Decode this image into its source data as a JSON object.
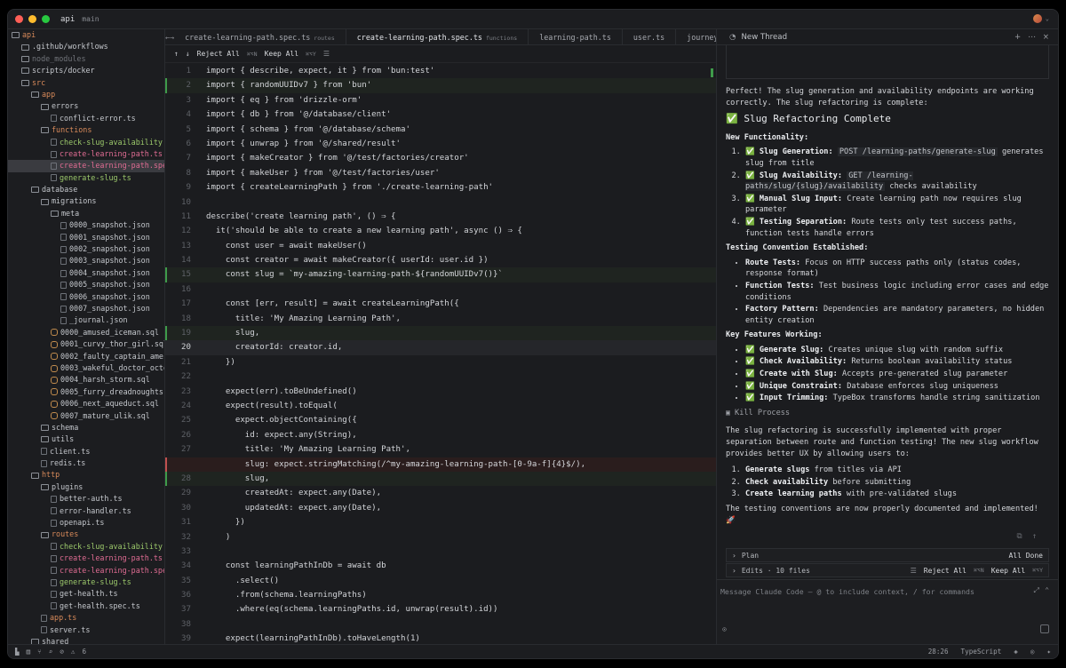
{
  "titlebar": {
    "project": "api",
    "branch": "main"
  },
  "sidebar": {
    "items": [
      {
        "label": "api",
        "depth": 0,
        "kind": "folder",
        "color": "orange"
      },
      {
        "label": ".github/workflows",
        "depth": 1,
        "kind": "folder",
        "color": ""
      },
      {
        "label": "node_modules",
        "depth": 1,
        "kind": "folder",
        "color": "dim"
      },
      {
        "label": "scripts/docker",
        "depth": 1,
        "kind": "folder",
        "color": ""
      },
      {
        "label": "src",
        "depth": 1,
        "kind": "folder",
        "color": "orange"
      },
      {
        "label": "app",
        "depth": 2,
        "kind": "folder",
        "color": "orange"
      },
      {
        "label": "errors",
        "depth": 3,
        "kind": "folder",
        "color": ""
      },
      {
        "label": "conflict-error.ts",
        "depth": 4,
        "kind": "file",
        "color": ""
      },
      {
        "label": "functions",
        "depth": 3,
        "kind": "folder",
        "color": "orange"
      },
      {
        "label": "check-slug-availability.ts",
        "depth": 4,
        "kind": "file",
        "color": "green"
      },
      {
        "label": "create-learning-path.ts",
        "depth": 4,
        "kind": "file",
        "color": "pink"
      },
      {
        "label": "create-learning-path.spec.ts",
        "depth": 4,
        "kind": "file",
        "color": "pink",
        "selected": true
      },
      {
        "label": "generate-slug.ts",
        "depth": 4,
        "kind": "file",
        "color": "green"
      },
      {
        "label": "database",
        "depth": 2,
        "kind": "folder",
        "color": ""
      },
      {
        "label": "migrations",
        "depth": 3,
        "kind": "folder",
        "color": ""
      },
      {
        "label": "meta",
        "depth": 4,
        "kind": "folder",
        "color": ""
      },
      {
        "label": "0000_snapshot.json",
        "depth": 5,
        "kind": "file",
        "color": ""
      },
      {
        "label": "0001_snapshot.json",
        "depth": 5,
        "kind": "file",
        "color": ""
      },
      {
        "label": "0002_snapshot.json",
        "depth": 5,
        "kind": "file",
        "color": ""
      },
      {
        "label": "0003_snapshot.json",
        "depth": 5,
        "kind": "file",
        "color": ""
      },
      {
        "label": "0004_snapshot.json",
        "depth": 5,
        "kind": "file",
        "color": ""
      },
      {
        "label": "0005_snapshot.json",
        "depth": 5,
        "kind": "file",
        "color": ""
      },
      {
        "label": "0006_snapshot.json",
        "depth": 5,
        "kind": "file",
        "color": ""
      },
      {
        "label": "0007_snapshot.json",
        "depth": 5,
        "kind": "file",
        "color": ""
      },
      {
        "label": "_journal.json",
        "depth": 5,
        "kind": "file",
        "color": ""
      },
      {
        "label": "0000_amused_iceman.sql",
        "depth": 4,
        "kind": "db",
        "color": ""
      },
      {
        "label": "0001_curvy_thor_girl.sql",
        "depth": 4,
        "kind": "db",
        "color": ""
      },
      {
        "label": "0002_faulty_captain_america",
        "depth": 4,
        "kind": "db",
        "color": ""
      },
      {
        "label": "0003_wakeful_doctor_octopu",
        "depth": 4,
        "kind": "db",
        "color": ""
      },
      {
        "label": "0004_harsh_storm.sql",
        "depth": 4,
        "kind": "db",
        "color": ""
      },
      {
        "label": "0005_furry_dreadnoughts.sql",
        "depth": 4,
        "kind": "db",
        "color": ""
      },
      {
        "label": "0006_next_aqueduct.sql",
        "depth": 4,
        "kind": "db",
        "color": ""
      },
      {
        "label": "0007_mature_ulik.sql",
        "depth": 4,
        "kind": "db",
        "color": ""
      },
      {
        "label": "schema",
        "depth": 3,
        "kind": "folder",
        "color": ""
      },
      {
        "label": "utils",
        "depth": 3,
        "kind": "folder",
        "color": ""
      },
      {
        "label": "client.ts",
        "depth": 3,
        "kind": "file",
        "color": ""
      },
      {
        "label": "redis.ts",
        "depth": 3,
        "kind": "file",
        "color": ""
      },
      {
        "label": "http",
        "depth": 2,
        "kind": "folder",
        "color": "orange"
      },
      {
        "label": "plugins",
        "depth": 3,
        "kind": "folder",
        "color": ""
      },
      {
        "label": "better-auth.ts",
        "depth": 4,
        "kind": "file",
        "color": ""
      },
      {
        "label": "error-handler.ts",
        "depth": 4,
        "kind": "file",
        "color": ""
      },
      {
        "label": "openapi.ts",
        "depth": 4,
        "kind": "file",
        "color": ""
      },
      {
        "label": "routes",
        "depth": 3,
        "kind": "folder",
        "color": "orange"
      },
      {
        "label": "check-slug-availability.ts",
        "depth": 4,
        "kind": "file",
        "color": "green"
      },
      {
        "label": "create-learning-path.ts",
        "depth": 4,
        "kind": "file",
        "color": "pink"
      },
      {
        "label": "create-learning-path.spec.",
        "depth": 4,
        "kind": "file",
        "color": "pink"
      },
      {
        "label": "generate-slug.ts",
        "depth": 4,
        "kind": "file",
        "color": "green"
      },
      {
        "label": "get-health.ts",
        "depth": 4,
        "kind": "file",
        "color": ""
      },
      {
        "label": "get-health.spec.ts",
        "depth": 4,
        "kind": "file",
        "color": ""
      },
      {
        "label": "app.ts",
        "depth": 3,
        "kind": "file",
        "color": "orange"
      },
      {
        "label": "server.ts",
        "depth": 3,
        "kind": "file",
        "color": ""
      },
      {
        "label": "shared",
        "depth": 2,
        "kind": "folder",
        "color": ""
      }
    ]
  },
  "editor": {
    "tabs": [
      {
        "label": "create-learning-path.spec.ts",
        "hint": "routes",
        "active": false
      },
      {
        "label": "create-learning-path.spec.ts",
        "hint": "functions",
        "active": true
      },
      {
        "label": "learning-path.ts",
        "hint": "",
        "active": false
      },
      {
        "label": "user.ts",
        "hint": "",
        "active": false
      },
      {
        "label": "journey.ts",
        "hint": "",
        "active": false
      },
      {
        "label": "_jou",
        "hint": "",
        "active": false
      }
    ],
    "review": {
      "reject_all": "Reject All",
      "reject_keys": "⌘⌥N",
      "keep_all": "Keep All",
      "keep_keys": "⌘⌥Y"
    },
    "lines": [
      {
        "n": "1",
        "text": "import { describe, expect, it } from 'bun:test'",
        "state": ""
      },
      {
        "n": "2",
        "text": "import { randomUUIDv7 } from 'bun'",
        "state": "added"
      },
      {
        "n": "3",
        "text": "import { eq } from 'drizzle-orm'",
        "state": ""
      },
      {
        "n": "4",
        "text": "import { db } from '@/database/client'",
        "state": ""
      },
      {
        "n": "5",
        "text": "import { schema } from '@/database/schema'",
        "state": ""
      },
      {
        "n": "6",
        "text": "import { unwrap } from '@/shared/result'",
        "state": ""
      },
      {
        "n": "7",
        "text": "import { makeCreator } from '@/test/factories/creator'",
        "state": ""
      },
      {
        "n": "8",
        "text": "import { makeUser } from '@/test/factories/user'",
        "state": ""
      },
      {
        "n": "9",
        "text": "import { createLearningPath } from './create-learning-path'",
        "state": ""
      },
      {
        "n": "10",
        "text": "",
        "state": ""
      },
      {
        "n": "11",
        "text": "describe('create learning path', () ⇒ {",
        "state": ""
      },
      {
        "n": "12",
        "text": "  it('should be able to create a new learning path', async () ⇒ {",
        "state": ""
      },
      {
        "n": "13",
        "text": "    const user = await makeUser()",
        "state": ""
      },
      {
        "n": "14",
        "text": "    const creator = await makeCreator({ userId: user.id })",
        "state": ""
      },
      {
        "n": "15",
        "text": "    const slug = `my-amazing-learning-path-${randomUUIDv7()}`",
        "state": "added"
      },
      {
        "n": "16",
        "text": "",
        "state": ""
      },
      {
        "n": "17",
        "text": "    const [err, result] = await createLearningPath({",
        "state": ""
      },
      {
        "n": "18",
        "text": "      title: 'My Amazing Learning Path',",
        "state": ""
      },
      {
        "n": "19",
        "text": "      slug,",
        "state": "added"
      },
      {
        "n": "20",
        "text": "      creatorId: creator.id,",
        "state": "cur"
      },
      {
        "n": "21",
        "text": "    })",
        "state": ""
      },
      {
        "n": "22",
        "text": "",
        "state": ""
      },
      {
        "n": "23",
        "text": "    expect(err).toBeUndefined()",
        "state": ""
      },
      {
        "n": "24",
        "text": "    expect(result).toEqual(",
        "state": ""
      },
      {
        "n": "25",
        "text": "      expect.objectContaining({",
        "state": ""
      },
      {
        "n": "26",
        "text": "        id: expect.any(String),",
        "state": ""
      },
      {
        "n": "27",
        "text": "        title: 'My Amazing Learning Path',",
        "state": ""
      },
      {
        "n": "",
        "text": "        slug: expect.stringMatching(/^my-amazing-learning-path-[0-9a-f]{4}$/),",
        "state": "removed"
      },
      {
        "n": "28",
        "text": "        slug,",
        "state": "added"
      },
      {
        "n": "29",
        "text": "        createdAt: expect.any(Date),",
        "state": ""
      },
      {
        "n": "30",
        "text": "        updatedAt: expect.any(Date),",
        "state": ""
      },
      {
        "n": "31",
        "text": "      })",
        "state": ""
      },
      {
        "n": "32",
        "text": "    )",
        "state": ""
      },
      {
        "n": "33",
        "text": "",
        "state": ""
      },
      {
        "n": "34",
        "text": "    const learningPathInDb = await db",
        "state": ""
      },
      {
        "n": "35",
        "text": "      .select()",
        "state": ""
      },
      {
        "n": "36",
        "text": "      .from(schema.learningPaths)",
        "state": ""
      },
      {
        "n": "37",
        "text": "      .where(eq(schema.learningPaths.id, unwrap(result).id))",
        "state": ""
      },
      {
        "n": "38",
        "text": "",
        "state": ""
      },
      {
        "n": "39",
        "text": "    expect(learningPathInDb).toHaveLength(1)",
        "state": ""
      }
    ]
  },
  "chat": {
    "title": "New Thread",
    "intro": "Perfect! The slug generation and availability endpoints are working correctly. The slug refactoring is complete:",
    "heading": "✅ Slug Refactoring Complete",
    "new_func_title": "New Functionality:",
    "new_func": [
      {
        "bold": "✅ Slug Generation:",
        "code": "POST /learning-paths/generate-slug",
        "rest": " generates slug from title"
      },
      {
        "bold": "✅ Slug Availability:",
        "code": "GET /learning-paths/slug/{slug}/availability",
        "rest": " checks availability"
      },
      {
        "bold": "✅ Manual Slug Input:",
        "code": "",
        "rest": " Create learning path now requires slug parameter"
      },
      {
        "bold": "✅ Testing Separation:",
        "code": "",
        "rest": " Route tests only test success paths, function tests handle errors"
      }
    ],
    "testing_title": "Testing Convention Established:",
    "testing": [
      {
        "bold": "Route Tests:",
        "rest": " Focus on HTTP success paths only (status codes, response format)"
      },
      {
        "bold": "Function Tests:",
        "rest": " Test business logic including error cases and edge conditions"
      },
      {
        "bold": "Factory Pattern:",
        "rest": " Dependencies are mandatory parameters, no hidden entity creation"
      }
    ],
    "features_title": "Key Features Working:",
    "features": [
      {
        "bold": "✅ Generate Slug:",
        "rest": " Creates unique slug with random suffix"
      },
      {
        "bold": "✅ Check Availability:",
        "rest": " Returns boolean availability status"
      },
      {
        "bold": "✅ Create with Slug:",
        "rest": " Accepts pre-generated slug parameter"
      },
      {
        "bold": "✅ Unique Constraint:",
        "rest": " Database enforces slug uniqueness"
      },
      {
        "bold": "✅ Input Trimming:",
        "rest": " TypeBox transforms handle string sanitization"
      }
    ],
    "kill_process": "Kill Process",
    "summary": "The slug refactoring is successfully implemented with proper separation between route and function testing! The new slug workflow provides better UX by allowing users to:",
    "steps": [
      {
        "bold": "Generate slugs",
        "rest": " from titles via API"
      },
      {
        "bold": "Check availability",
        "rest": " before submitting"
      },
      {
        "bold": "Create learning paths",
        "rest": " with pre-validated slugs"
      }
    ],
    "closing": "The testing conventions are now properly documented and implemented! 🚀",
    "plan_label": "Plan",
    "plan_status": "All Done",
    "edits_label": "Edits · 10 files",
    "reject_all": "Reject All",
    "reject_keys": "⌘⌥N",
    "keep_all": "Keep All",
    "keep_keys": "⌘⌥Y",
    "input_placeholder": "Message Claude Code — @ to include context, / for commands"
  },
  "statusbar": {
    "warnings": "6",
    "position": "28:26",
    "language": "TypeScript"
  }
}
